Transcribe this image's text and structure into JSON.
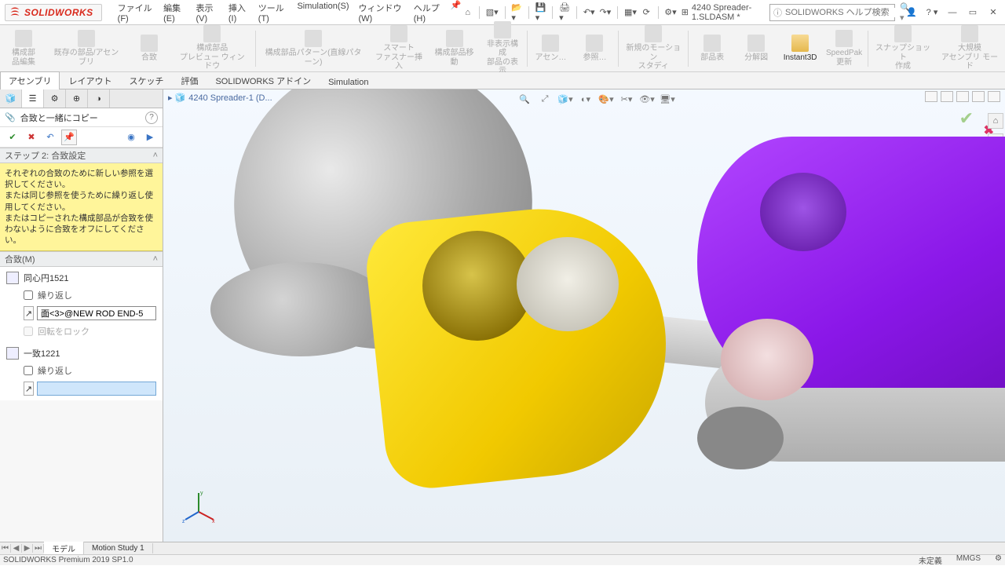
{
  "app": {
    "brand": "SOLIDWORKS",
    "pin": "📌"
  },
  "menus": [
    "ファイル(F)",
    "編集(E)",
    "表示(V)",
    "挿入(I)",
    "ツール(T)",
    "Simulation(S)",
    "ウィンドウ(W)",
    "ヘルプ(H)"
  ],
  "doc": {
    "icon": "⊞",
    "name": "4240 Spreader-1.SLDASM *"
  },
  "search": {
    "placeholder": "SOLIDWORKS ヘルプ検索"
  },
  "ribbon": [
    {
      "l1": "構成部",
      "l2": "品編集",
      "en": false
    },
    {
      "l1": "既存の部品/アセンブリ",
      "en": false
    },
    {
      "l1": "合致",
      "en": false
    },
    {
      "l1": "構成部品",
      "l2": "プレビュー ウィンドウ",
      "en": false
    },
    {
      "l1": "構成部品パターン(直線パターン)",
      "en": false
    },
    {
      "l1": "スマート",
      "l2": "ファスナー挿入",
      "en": false
    },
    {
      "l1": "構成部品移動",
      "en": false
    },
    {
      "l1": "非表示構成",
      "l2": "部品の表示",
      "en": false
    },
    {
      "l1": "アセン…",
      "en": false
    },
    {
      "l1": "参照…",
      "en": false
    },
    {
      "l1": "新規のモーション",
      "l2": "スタディ",
      "en": false
    },
    {
      "l1": "部品表",
      "en": false
    },
    {
      "l1": "分解図",
      "en": false
    },
    {
      "l1": "Instant3D",
      "en": true
    },
    {
      "l1": "SpeedPak",
      "l2": "更新",
      "en": false
    },
    {
      "l1": "スナップショット",
      "l2": "作成",
      "en": false
    },
    {
      "l1": "大規模",
      "l2": "アセンブリ モード",
      "en": false
    }
  ],
  "cm_tabs": [
    "アセンブリ",
    "レイアウト",
    "スケッチ",
    "評価",
    "SOLIDWORKS アドイン",
    "Simulation"
  ],
  "cm_active": 0,
  "crumb": "4240 Spreader-1 (D...",
  "pm": {
    "title": "合致と一緒にコピー",
    "step_title": "ステップ 2: 合致設定",
    "note": "それぞれの合致のために新しい参照を選択してください。\nまたは同じ参照を使うために繰り返し使用してください。\nまたはコピーされた構成部品が合致を使わないように合致をオフにしてください。",
    "mates_header": "合致(M)",
    "mate1": {
      "name": "同心円1521",
      "repeat": "繰り返し",
      "ref": "面<3>@NEW ROD END-5",
      "lock": "回転をロック"
    },
    "mate2": {
      "name": "一致1221",
      "repeat": "繰り返し",
      "ref": ""
    }
  },
  "motion_tabs": [
    "モデル",
    "Motion Study 1"
  ],
  "status": {
    "left": "SOLIDWORKS Premium 2019 SP1.0",
    "mode": "未定義",
    "units": "MMGS"
  }
}
